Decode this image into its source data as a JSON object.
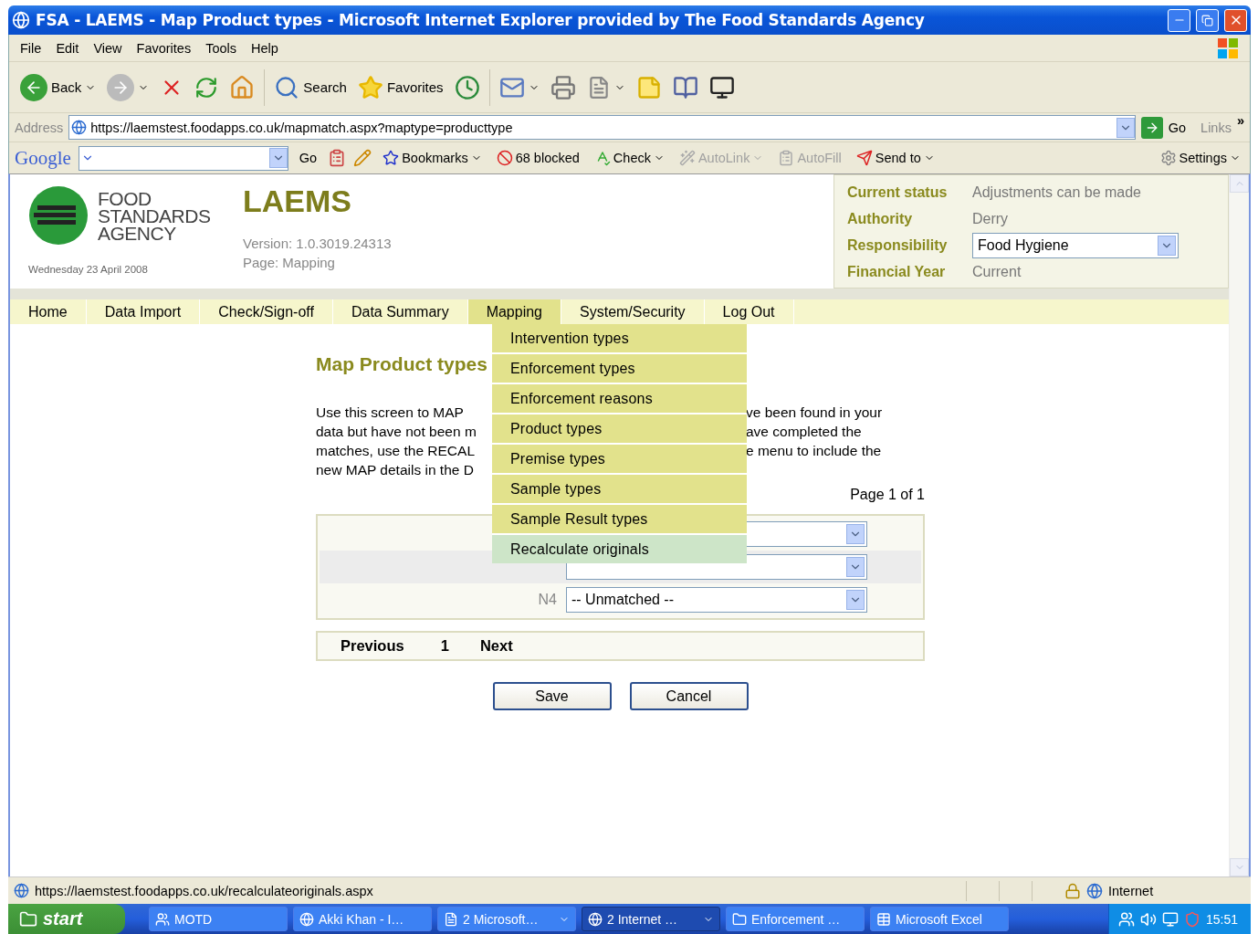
{
  "window": {
    "title": "FSA - LAEMS - Map Product types - Microsoft Internet Explorer provided by The Food Standards Agency"
  },
  "menu_bar": [
    "File",
    "Edit",
    "View",
    "Favorites",
    "Tools",
    "Help"
  ],
  "toolbar": {
    "back": "Back",
    "search": "Search",
    "favorites": "Favorites"
  },
  "address_bar": {
    "label": "Address",
    "url": "https://laemstest.foodapps.co.uk/mapmatch.aspx?maptype=producttype",
    "go": "Go",
    "links": "Links",
    "more": "»"
  },
  "google_bar": {
    "logo": "Google",
    "go": "Go",
    "items": [
      {
        "label": "Bookmarks",
        "disabled": false,
        "menu": true
      },
      {
        "label": "68 blocked",
        "disabled": false,
        "menu": false
      },
      {
        "label": "Check",
        "disabled": false,
        "menu": true
      },
      {
        "label": "AutoLink",
        "disabled": true,
        "menu": true
      },
      {
        "label": "AutoFill",
        "disabled": true,
        "menu": false
      },
      {
        "label": "Send to",
        "disabled": false,
        "menu": true
      }
    ],
    "settings": "Settings"
  },
  "header": {
    "logo_lines": [
      "FOOD",
      "STANDARDS",
      "AGENCY"
    ],
    "date": "Wednesday 23 April 2008",
    "app": "LAEMS",
    "version": "Version: 1.0.3019.24313",
    "page": "Page: Mapping",
    "status": [
      {
        "label": "Current status",
        "value": "Adjustments can be made",
        "kind": "text"
      },
      {
        "label": "Authority",
        "value": "Derry",
        "kind": "text"
      },
      {
        "label": "Responsibility",
        "value": "Food Hygiene",
        "kind": "select"
      },
      {
        "label": "Financial Year",
        "value": "Current",
        "kind": "text"
      }
    ]
  },
  "nav": {
    "tabs": [
      {
        "label": "Home",
        "selected": false
      },
      {
        "label": "Data Import",
        "selected": false
      },
      {
        "label": "Check/Sign-off",
        "selected": false
      },
      {
        "label": "Data Summary",
        "selected": false
      },
      {
        "label": "Mapping",
        "selected": true
      },
      {
        "label": "System/Security",
        "selected": false
      },
      {
        "label": "Log Out",
        "selected": false
      }
    ],
    "submenu": [
      {
        "label": "Intervention types",
        "selected": false
      },
      {
        "label": "Enforcement types",
        "selected": false
      },
      {
        "label": "Enforcement reasons",
        "selected": false
      },
      {
        "label": "Product types",
        "selected": false
      },
      {
        "label": "Premise types",
        "selected": false
      },
      {
        "label": "Sample types",
        "selected": false
      },
      {
        "label": "Sample Result types",
        "selected": false
      },
      {
        "label": "Recalculate originals",
        "selected": true
      }
    ]
  },
  "content": {
    "title": "Map Product types",
    "intro_left": [
      "Use this screen to MAP",
      "data but have not been m",
      "matches, use the RECAL",
      "new MAP details in the D"
    ],
    "intro_right": [
      "ve been found in your",
      "ave completed the",
      "e menu to include the"
    ],
    "page_info": "Page 1 of 1",
    "rows": [
      {},
      {},
      {
        "label": "N4",
        "value": "-- Unmatched --"
      }
    ],
    "pager": {
      "previous": "Previous",
      "current": "1",
      "next": "Next"
    },
    "buttons": [
      "Save",
      "Cancel"
    ]
  },
  "status_bar": {
    "url": "https://laemstest.foodapps.co.uk/recalculateoriginals.aspx",
    "zone": "Internet"
  },
  "taskbar": {
    "start": "start",
    "tasks": [
      {
        "label": "MOTD",
        "active": false,
        "grouped": false
      },
      {
        "label": "Akki Khan - I…",
        "active": false,
        "grouped": false
      },
      {
        "label": "2 Microsoft…",
        "active": false,
        "grouped": true
      },
      {
        "label": "2 Internet …",
        "active": true,
        "grouped": true
      },
      {
        "label": "Enforcement …",
        "active": false,
        "grouped": false
      },
      {
        "label": "Microsoft Excel",
        "active": false,
        "grouped": false
      }
    ],
    "clock": "15:51"
  }
}
